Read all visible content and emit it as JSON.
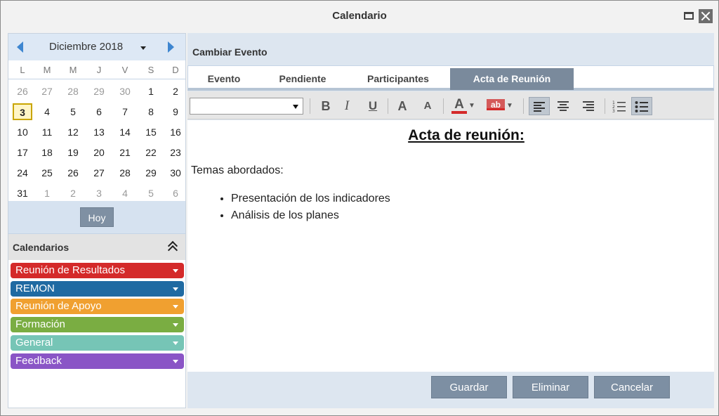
{
  "window": {
    "title": "Calendario"
  },
  "minicalendar": {
    "month_label": "Diciembre 2018",
    "weekdays": [
      "L",
      "M",
      "M",
      "J",
      "V",
      "S",
      "D"
    ],
    "weeks": [
      [
        "26",
        "27",
        "28",
        "29",
        "30",
        "1",
        "2"
      ],
      [
        "3",
        "4",
        "5",
        "6",
        "7",
        "8",
        "9"
      ],
      [
        "10",
        "11",
        "12",
        "13",
        "14",
        "15",
        "16"
      ],
      [
        "17",
        "18",
        "19",
        "20",
        "21",
        "22",
        "23"
      ],
      [
        "24",
        "25",
        "26",
        "27",
        "28",
        "29",
        "30"
      ],
      [
        "31",
        "1",
        "2",
        "3",
        "4",
        "5",
        "6"
      ]
    ],
    "today_button": "Hoy"
  },
  "calendars": {
    "title": "Calendarios",
    "items": [
      {
        "label": "Reunión de Resultados",
        "color": "#d42a2a"
      },
      {
        "label": "REMON",
        "color": "#1f6aa2"
      },
      {
        "label": "Reunión de Apoyo",
        "color": "#f0a030"
      },
      {
        "label": "Formación",
        "color": "#7aad42"
      },
      {
        "label": "General",
        "color": "#76c5b6"
      },
      {
        "label": "Feedback",
        "color": "#8a55c6"
      }
    ]
  },
  "event": {
    "panel_title": "Cambiar Evento",
    "tabs": [
      "Evento",
      "Pendiente",
      "Participantes",
      "Acta de Reunión"
    ],
    "active_tab": "Acta de Reunión"
  },
  "editor": {
    "heading": "Acta de reunión:",
    "intro": "Temas abordados:",
    "bullets": [
      "Presentación de los indicadores",
      "Análisis de los planes"
    ]
  },
  "toolbar": {
    "bold": "B",
    "italic": "I",
    "underline": "U",
    "grow_font": "A",
    "shrink_font": "A",
    "font_color": "A",
    "highlight": "ab"
  },
  "actions": {
    "save": "Guardar",
    "delete": "Eliminar",
    "cancel": "Cancelar"
  }
}
